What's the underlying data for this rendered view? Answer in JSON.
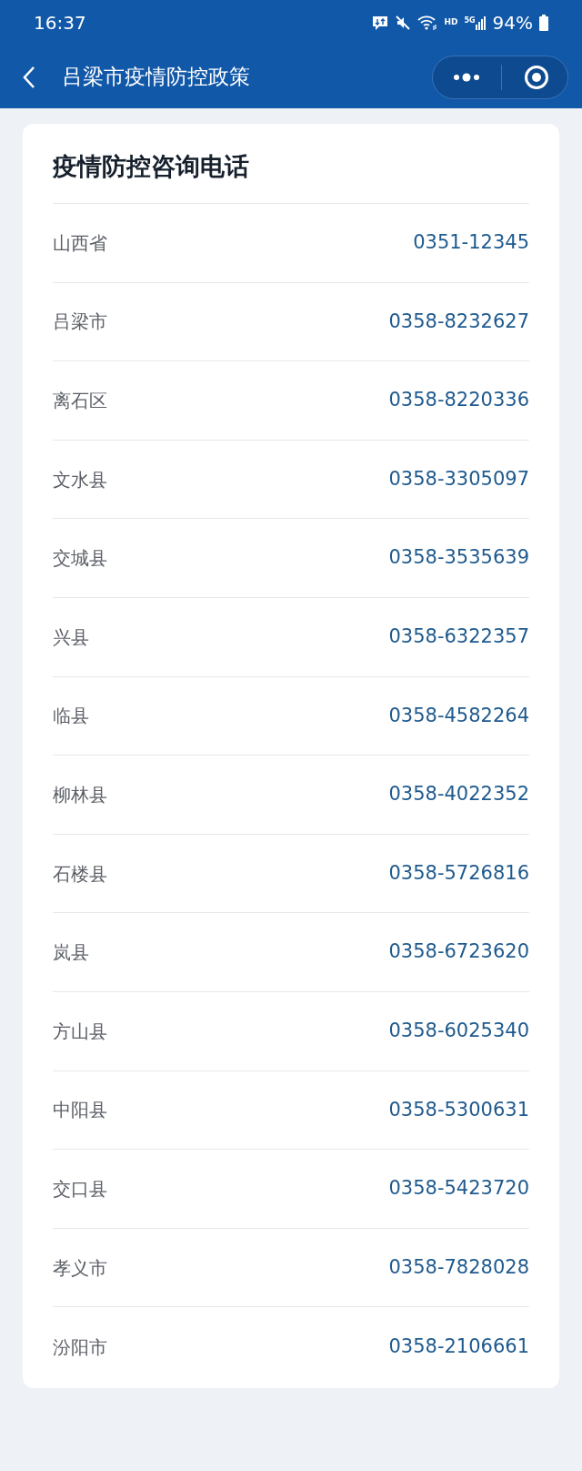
{
  "status_bar": {
    "time": "16:37",
    "network": "HD",
    "cellular": "5G",
    "battery": "94%"
  },
  "nav": {
    "title": "吕梁市疫情防控政策"
  },
  "card": {
    "title": "疫情防控咨询电话",
    "rows": [
      {
        "region": "山西省",
        "phone": "0351-12345"
      },
      {
        "region": "吕梁市",
        "phone": "0358-8232627"
      },
      {
        "region": "离石区",
        "phone": "0358-8220336"
      },
      {
        "region": "文水县",
        "phone": "0358-3305097"
      },
      {
        "region": "交城县",
        "phone": "0358-3535639"
      },
      {
        "region": "兴县",
        "phone": "0358-6322357"
      },
      {
        "region": "临县",
        "phone": "0358-4582264"
      },
      {
        "region": "柳林县",
        "phone": "0358-4022352"
      },
      {
        "region": "石楼县",
        "phone": "0358-5726816"
      },
      {
        "region": "岚县",
        "phone": "0358-6723620"
      },
      {
        "region": "方山县",
        "phone": "0358-6025340"
      },
      {
        "region": "中阳县",
        "phone": "0358-5300631"
      },
      {
        "region": "交口县",
        "phone": "0358-5423720"
      },
      {
        "region": "孝义市",
        "phone": "0358-7828028"
      },
      {
        "region": "汾阳市",
        "phone": "0358-2106661"
      }
    ]
  }
}
